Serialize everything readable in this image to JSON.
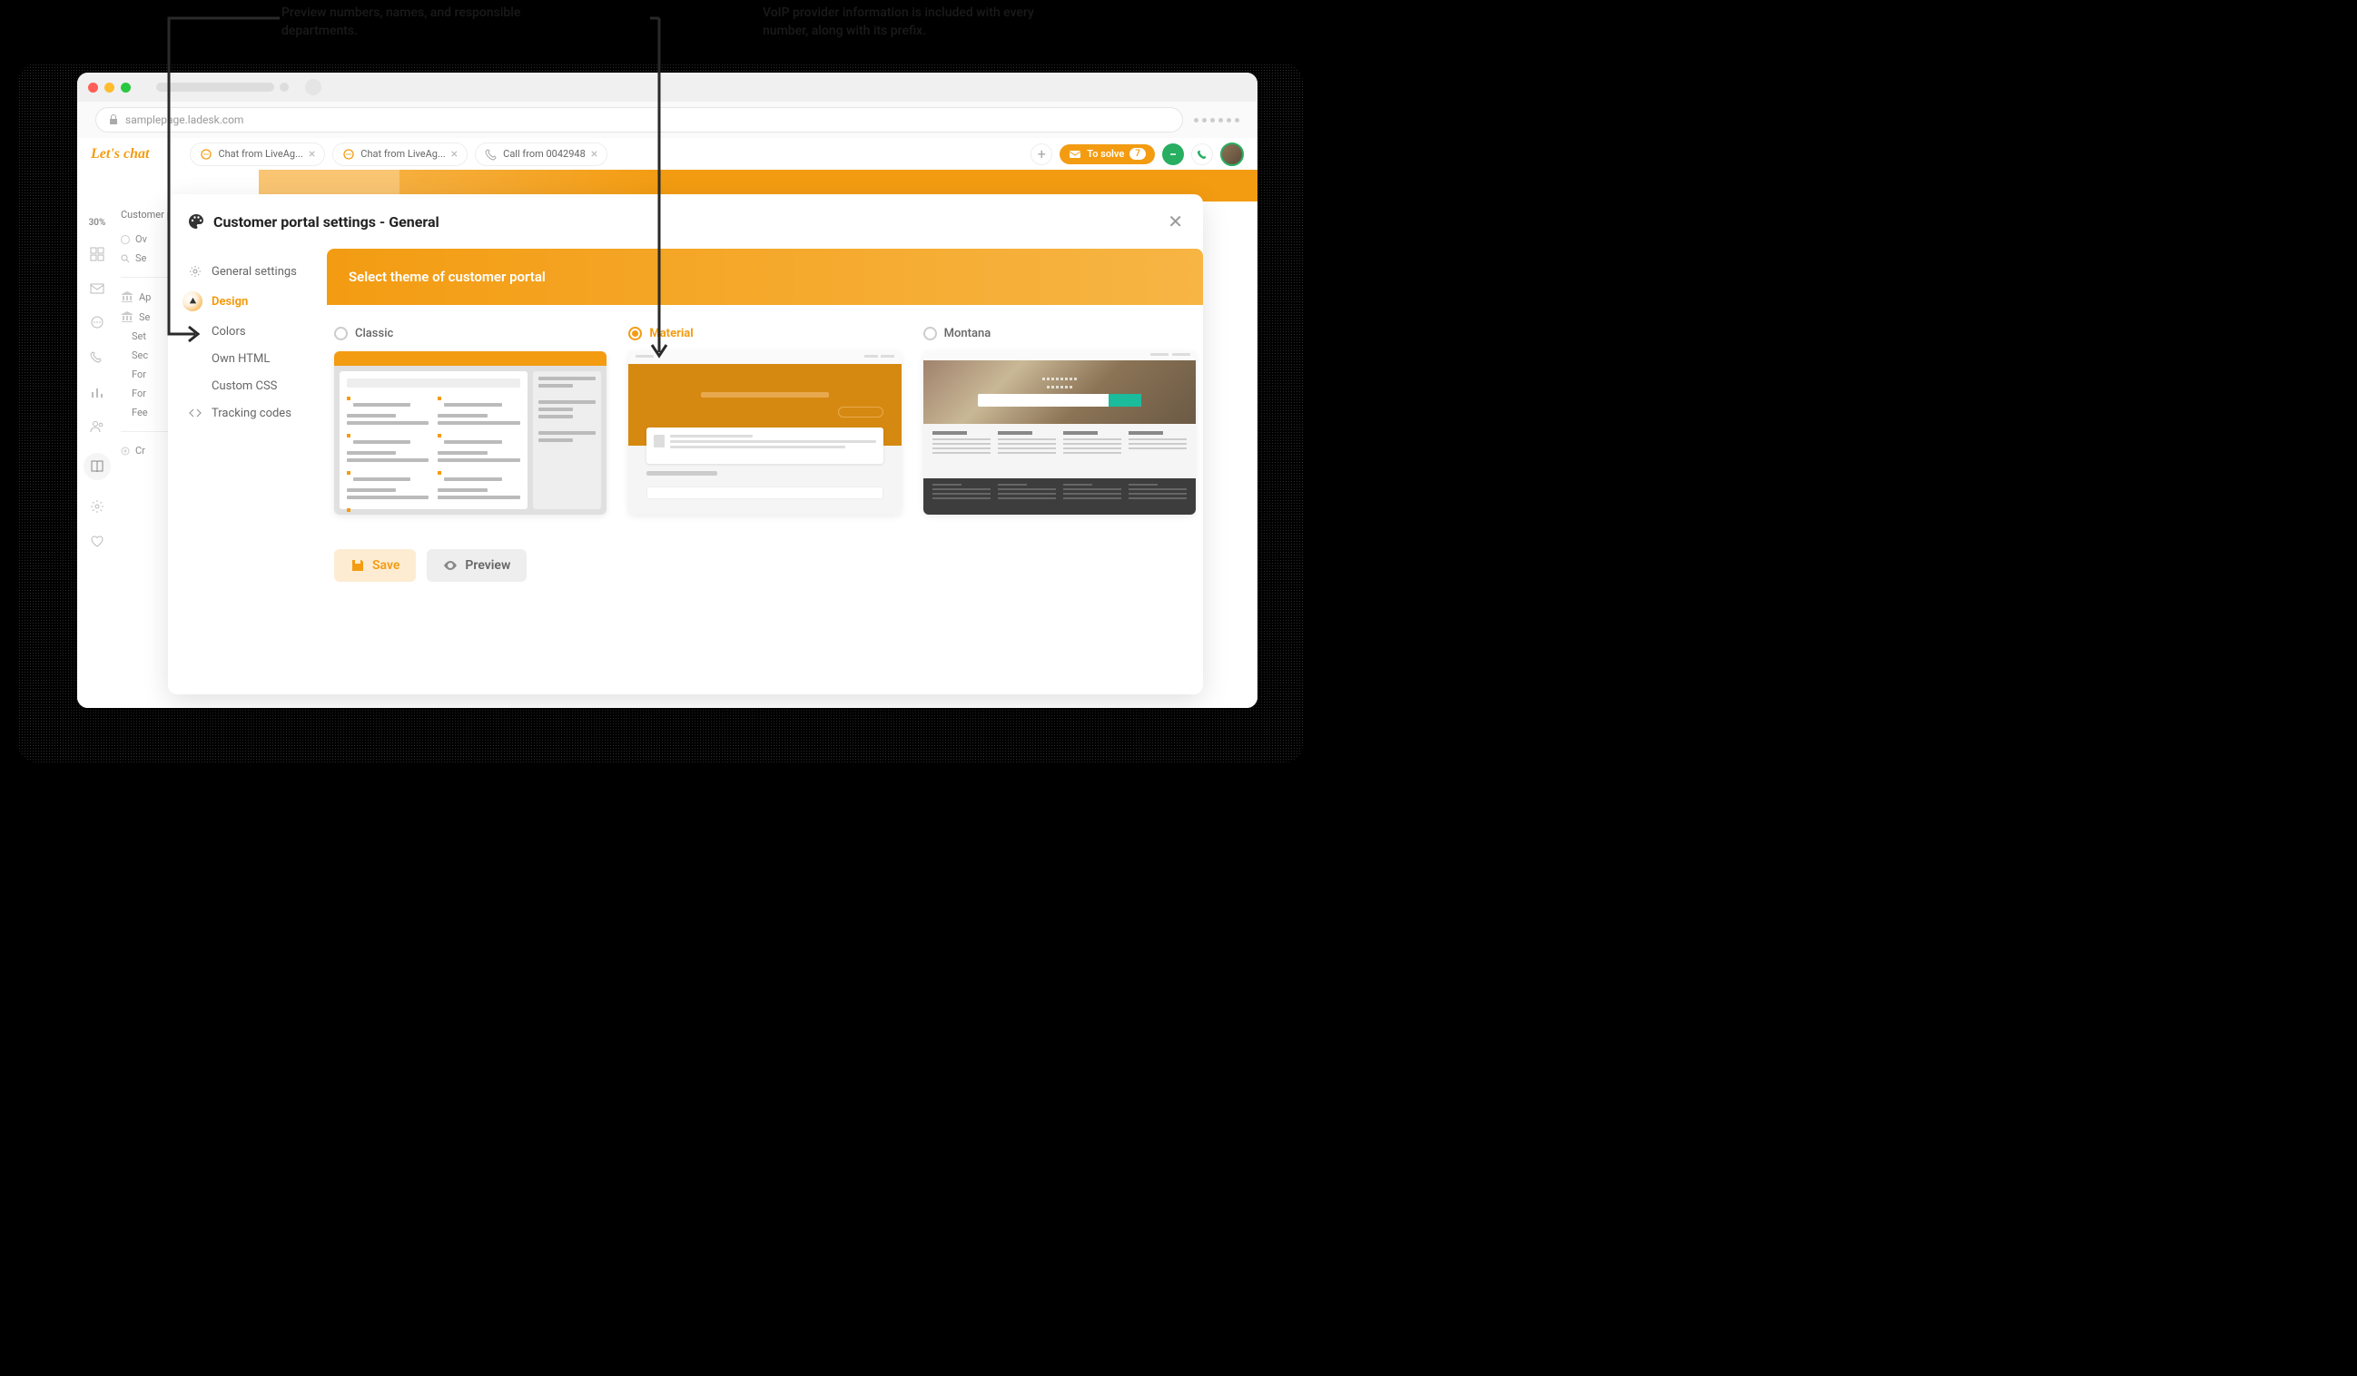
{
  "annotations": {
    "left": "Preview numbers, names, and responsible departments.",
    "right": "VoIP provider information is included with every number, along with its prefix."
  },
  "browser": {
    "url": "samplepage.ladesk.com"
  },
  "app": {
    "logo": "Let's chat",
    "tabs": [
      {
        "icon": "chat",
        "label": "Chat from LiveAg..."
      },
      {
        "icon": "chat",
        "label": "Chat from LiveAg..."
      },
      {
        "icon": "phone",
        "label": "Call from 0042948"
      }
    ],
    "to_solve": {
      "label": "To solve",
      "count": "7"
    },
    "progress": "30%"
  },
  "sidebar": {
    "title": "Customer portal",
    "items": [
      {
        "label": "Ov"
      },
      {
        "label": "Se"
      }
    ],
    "group2": [
      {
        "label": "Ap"
      },
      {
        "label": "Se"
      },
      {
        "label": "Set",
        "sub": true
      },
      {
        "label": "Sec",
        "sub": true
      },
      {
        "label": "For",
        "sub": true
      },
      {
        "label": "For",
        "sub": true
      },
      {
        "label": "Fee",
        "sub": true
      }
    ],
    "group3": [
      {
        "label": "Cr"
      }
    ]
  },
  "modal": {
    "title": "Customer portal settings - General",
    "nav": [
      {
        "icon": "gear",
        "label": "General settings"
      },
      {
        "icon": "design",
        "label": "Design",
        "active": true
      },
      {
        "icon": "",
        "label": "Colors"
      },
      {
        "icon": "",
        "label": "Own HTML"
      },
      {
        "icon": "",
        "label": "Custom CSS"
      },
      {
        "icon": "code",
        "label": "Tracking codes"
      }
    ],
    "content_header": "Select theme of customer portal",
    "themes": [
      {
        "name": "Classic",
        "selected": false
      },
      {
        "name": "Material",
        "selected": true
      },
      {
        "name": "Montana",
        "selected": false
      }
    ],
    "actions": {
      "save": "Save",
      "preview": "Preview"
    }
  }
}
